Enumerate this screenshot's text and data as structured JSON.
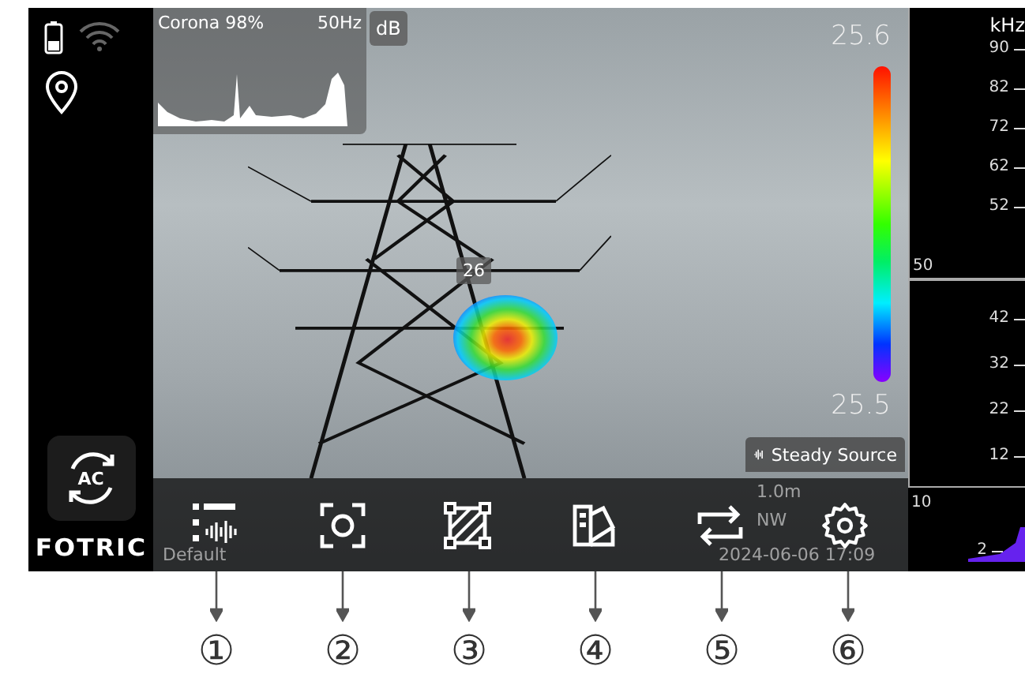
{
  "sidebar": {
    "ac_button": {
      "label": "AC"
    },
    "logo": "FOTRIC"
  },
  "mini_spectrum": {
    "title": "Corona 98%",
    "frequency": "50Hz",
    "unit_button": "dB"
  },
  "color_scale": {
    "max": "25.6",
    "min": "25.5"
  },
  "hotspot": {
    "label": "26"
  },
  "source_badge": {
    "label": "Steady Source"
  },
  "faded_info": {
    "distance": "1.0m",
    "direction": "NW",
    "timestamp": "2024-06-06 17:09",
    "preset": "Default"
  },
  "toolbar": [
    {
      "kind": "spectrum-list"
    },
    {
      "kind": "capture"
    },
    {
      "kind": "region"
    },
    {
      "kind": "palette"
    },
    {
      "kind": "switch"
    },
    {
      "kind": "settings"
    }
  ],
  "frequency_panel": {
    "unit": "kHz",
    "upper_ticks": [
      "90",
      "82",
      "72",
      "62",
      "52"
    ],
    "upper_corner": "50",
    "lower_ticks": [
      "42",
      "32",
      "22",
      "12"
    ],
    "lower_corner": "10",
    "bottom_tick": "2"
  },
  "callouts": [
    "①",
    "②",
    "③",
    "④",
    "⑤",
    "⑥"
  ]
}
